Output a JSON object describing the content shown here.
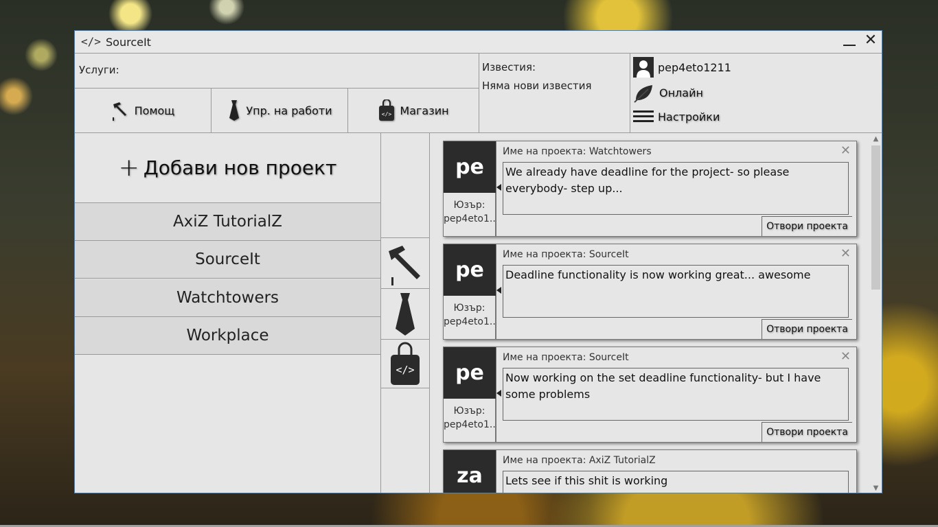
{
  "app": {
    "logo": "</>",
    "title": "SourceIt"
  },
  "header": {
    "services_label": "Услуги:",
    "nav": [
      {
        "label": "Помощ",
        "icon": "hammer-icon"
      },
      {
        "label": "Упр. на работи",
        "icon": "tie-icon"
      },
      {
        "label": "Магазин",
        "icon": "shopping-bag-code-icon"
      }
    ]
  },
  "notifications": {
    "title": "Известия:",
    "text": "Няма нови известия"
  },
  "user": {
    "username": "pep4eto1211",
    "status": "Онлайн",
    "settings": "Настройки"
  },
  "projects": {
    "add_label": "Добави нов проект",
    "items": [
      "AxiZ TutorialZ",
      "SourceIt",
      "Watchtowers",
      "Workplace"
    ]
  },
  "feed": {
    "user_prefix": "Юзър:",
    "open_label": "Отвори проекта",
    "cards": [
      {
        "initials": "pe",
        "user": "pep4eto1...",
        "project": "Име на проекта: Watchtowers",
        "message": "We already have deadline for the project- so please everybody- step up..."
      },
      {
        "initials": "pe",
        "user": "pep4eto1...",
        "project": "Име на проекта: SourceIt",
        "message": "Deadline functionality is now working great... awesome"
      },
      {
        "initials": "pe",
        "user": "pep4eto1...",
        "project": "Име на проекта: SourceIt",
        "message": "Now working on the set deadline functionality- but I have some problems"
      },
      {
        "initials": "za",
        "user": "",
        "project": "Име на проекта: AxiZ TutorialZ",
        "message": "Lets see if this shit is working"
      }
    ]
  },
  "colors": {
    "window_border": "#3b87d6",
    "avatar_bg": "#2b2b2b",
    "panel_bg": "#e6e6e6"
  }
}
